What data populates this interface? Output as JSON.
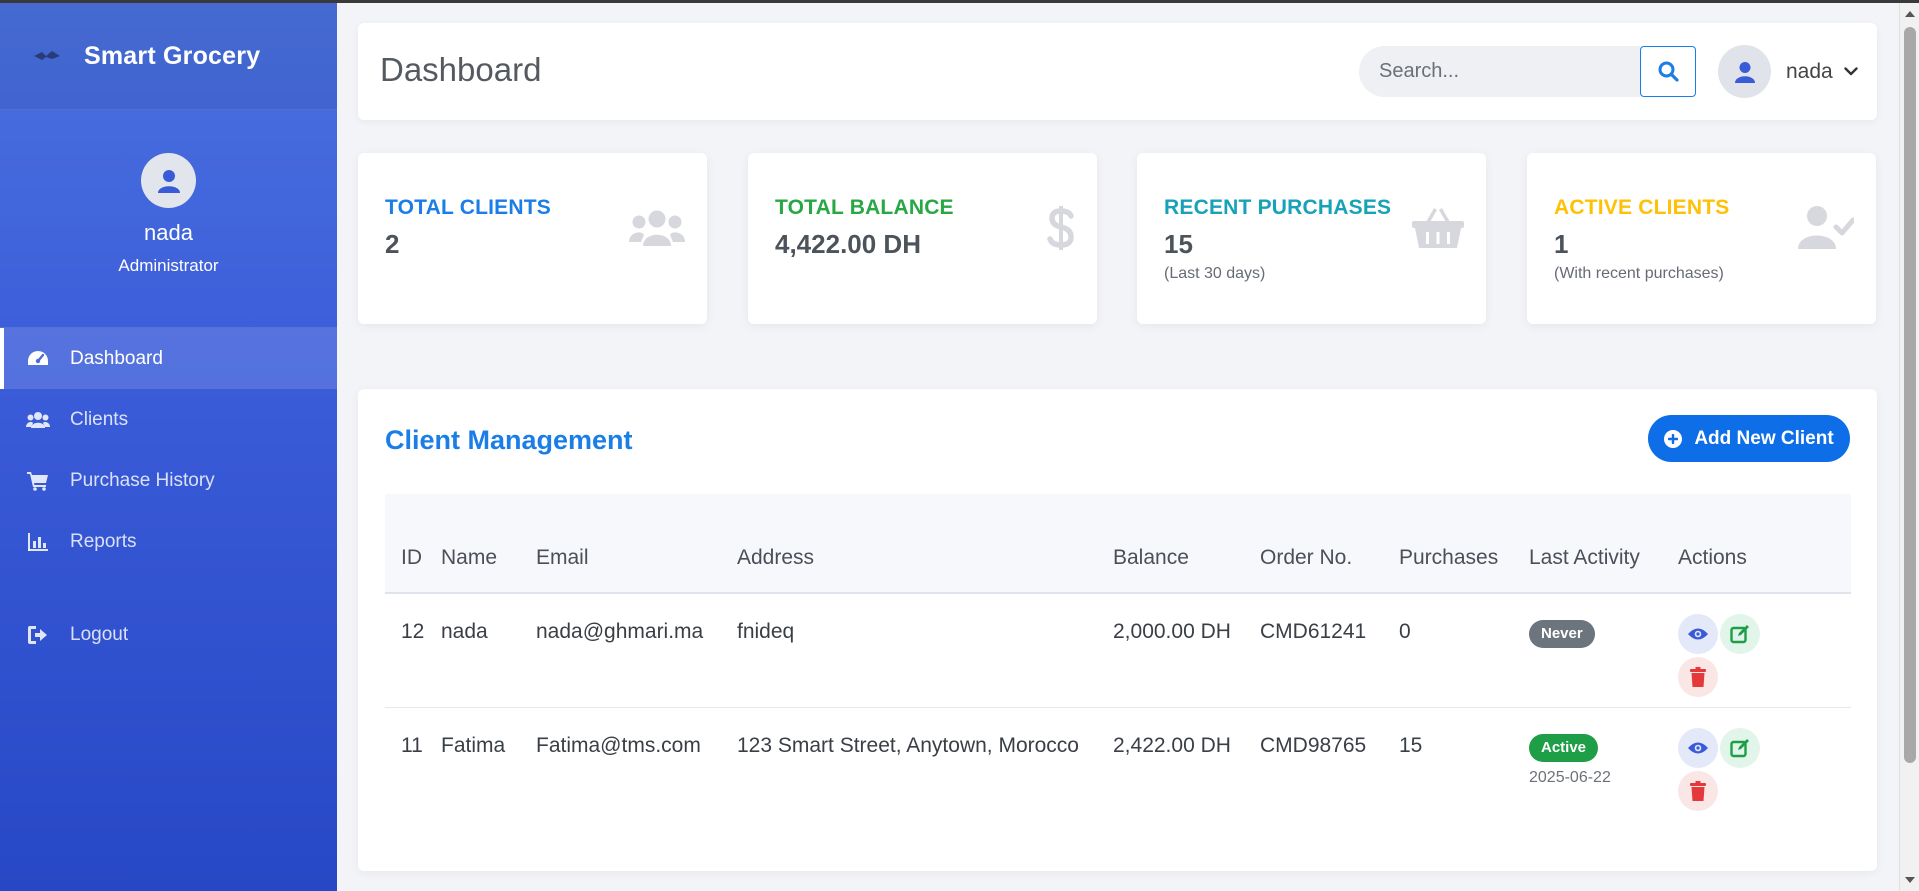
{
  "app": {
    "brand": "Smart Grocery",
    "page_title": "Dashboard",
    "accent_color": "#1a7de8",
    "sidebar_color": "#3a5bd8"
  },
  "sidebar": {
    "profile": {
      "name": "nada",
      "role": "Administrator"
    },
    "items": [
      {
        "label": "Dashboard",
        "icon": "tachometer-icon",
        "active": true
      },
      {
        "label": "Clients",
        "icon": "users-icon",
        "active": false
      },
      {
        "label": "Purchase History",
        "icon": "shopping-cart-icon",
        "active": false
      },
      {
        "label": "Reports",
        "icon": "bar-chart-icon",
        "active": false
      },
      {
        "label": "Logout",
        "icon": "sign-out-icon",
        "active": false
      }
    ]
  },
  "header": {
    "search": {
      "placeholder": "Search...",
      "value": ""
    },
    "user": {
      "name": "nada"
    }
  },
  "stats": [
    {
      "label": "TOTAL CLIENTS",
      "value": "2",
      "sub": "",
      "color": "#1a7de8",
      "icon": "users-icon"
    },
    {
      "label": "TOTAL BALANCE",
      "value": "4,422.00 DH",
      "sub": "",
      "color": "#28a745",
      "icon": "dollar-icon"
    },
    {
      "label": "RECENT PURCHASES",
      "value": "15",
      "sub": "(Last 30 days)",
      "color": "#17a2b8",
      "icon": "basket-icon"
    },
    {
      "label": "ACTIVE CLIENTS",
      "value": "1",
      "sub": "(With recent purchases)",
      "color": "#ffc107",
      "icon": "user-check-icon"
    }
  ],
  "client_management": {
    "title": "Client Management",
    "add_button": "Add New Client",
    "columns": [
      "ID",
      "Name",
      "Email",
      "Address",
      "Balance",
      "Order No.",
      "Purchases",
      "Last Activity",
      "Actions"
    ],
    "rows": [
      {
        "id": "12",
        "name": "nada",
        "email": "nada@ghmari.ma",
        "address": "fnideq",
        "balance": "2,000.00 DH",
        "order_no": "CMD61241",
        "purchases": "0",
        "status": "Never",
        "last_date": ""
      },
      {
        "id": "11",
        "name": "Fatima",
        "email": "Fatima@tms.com",
        "address": "123 Smart Street, Anytown, Morocco",
        "balance": "2,422.00 DH",
        "order_no": "CMD98765",
        "purchases": "15",
        "status": "Active",
        "last_date": "2025-06-22"
      }
    ]
  }
}
